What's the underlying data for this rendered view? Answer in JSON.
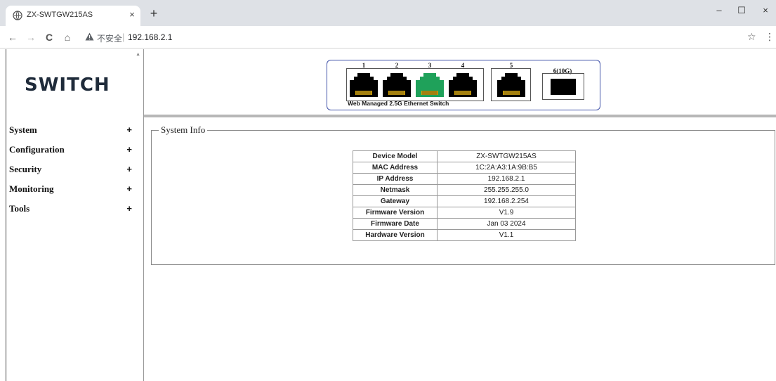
{
  "browser": {
    "tab_title": "ZX-SWTGW215AS",
    "tab_close": "×",
    "new_tab": "+",
    "window_controls": {
      "minimize": "–",
      "maximize": "☐",
      "close": "×"
    },
    "nav": {
      "back": "←",
      "forward": "→",
      "reload": "C",
      "home": "⌂"
    },
    "security_label": "不安全",
    "url": "192.168.2.1",
    "star": "☆",
    "menu": "⋮"
  },
  "sidebar": {
    "logo": "SWITCH",
    "items": [
      {
        "label": "System",
        "expand": "+"
      },
      {
        "label": "Configuration",
        "expand": "+"
      },
      {
        "label": "Security",
        "expand": "+"
      },
      {
        "label": "Monitoring",
        "expand": "+"
      },
      {
        "label": "Tools",
        "expand": "+"
      }
    ]
  },
  "panel": {
    "ports": [
      {
        "number": "1",
        "active": false,
        "color": "#000000"
      },
      {
        "number": "2",
        "active": false,
        "color": "#000000"
      },
      {
        "number": "3",
        "active": true,
        "color": "#1fa15a"
      },
      {
        "number": "4",
        "active": false,
        "color": "#000000"
      },
      {
        "number": "5",
        "active": false,
        "color": "#000000"
      }
    ],
    "sfp_port": "6(10G)",
    "label": "Web Managed 2.5G Ethernet Switch"
  },
  "system_info": {
    "legend": "System Info",
    "rows": [
      {
        "key": "Device Model",
        "value": "ZX-SWTGW215AS"
      },
      {
        "key": "MAC Address",
        "value": "1C:2A:A3:1A:9B:B5"
      },
      {
        "key": "IP Address",
        "value": "192.168.2.1"
      },
      {
        "key": "Netmask",
        "value": "255.255.255.0"
      },
      {
        "key": "Gateway",
        "value": "192.168.2.254"
      },
      {
        "key": "Firmware Version",
        "value": "V1.9"
      },
      {
        "key": "Firmware Date",
        "value": "Jan 03 2024"
      },
      {
        "key": "Hardware Version",
        "value": "V1.1"
      }
    ]
  },
  "colors": {
    "port_active": "#1fa15a",
    "port_inactive": "#000000",
    "port_contacts": "#d4a200",
    "panel_border": "#3f51a8"
  }
}
